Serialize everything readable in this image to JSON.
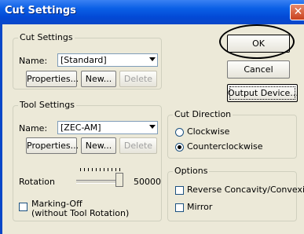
{
  "window": {
    "title": "Cut Settings",
    "close_glyph": "✕"
  },
  "cut_settings": {
    "legend": "Cut Settings",
    "name_label": "Name:",
    "name_value": "[Standard]",
    "properties_label": "Properties...",
    "new_label": "New...",
    "delete_label": "Delete"
  },
  "tool_settings": {
    "legend": "Tool Settings",
    "name_label": "Name:",
    "name_value": "[ZEC-AM]",
    "properties_label": "Properties...",
    "new_label": "New...",
    "delete_label": "Delete",
    "rotation_label": "Rotation",
    "rotation_value": "50000",
    "rotation_level": 1.0,
    "marking_off_line1": "Marking-Off",
    "marking_off_line2": "(without Tool Rotation)",
    "marking_off_checked": false
  },
  "buttons": {
    "ok_label": "OK",
    "cancel_label": "Cancel",
    "output_device_label": "Output Device..."
  },
  "cut_direction": {
    "legend": "Cut Direction",
    "clockwise_label": "Clockwise",
    "counterclockwise_label": "Counterclockwise",
    "selected": "Counterclockwise"
  },
  "options": {
    "legend": "Options",
    "reverse_label": "Reverse Concavity/Convexity",
    "mirror_label": "Mirror",
    "reverse_checked": false,
    "mirror_checked": false
  },
  "colors": {
    "titlebar": "#0a5fe6",
    "dialog_bg": "#ece9d8"
  }
}
